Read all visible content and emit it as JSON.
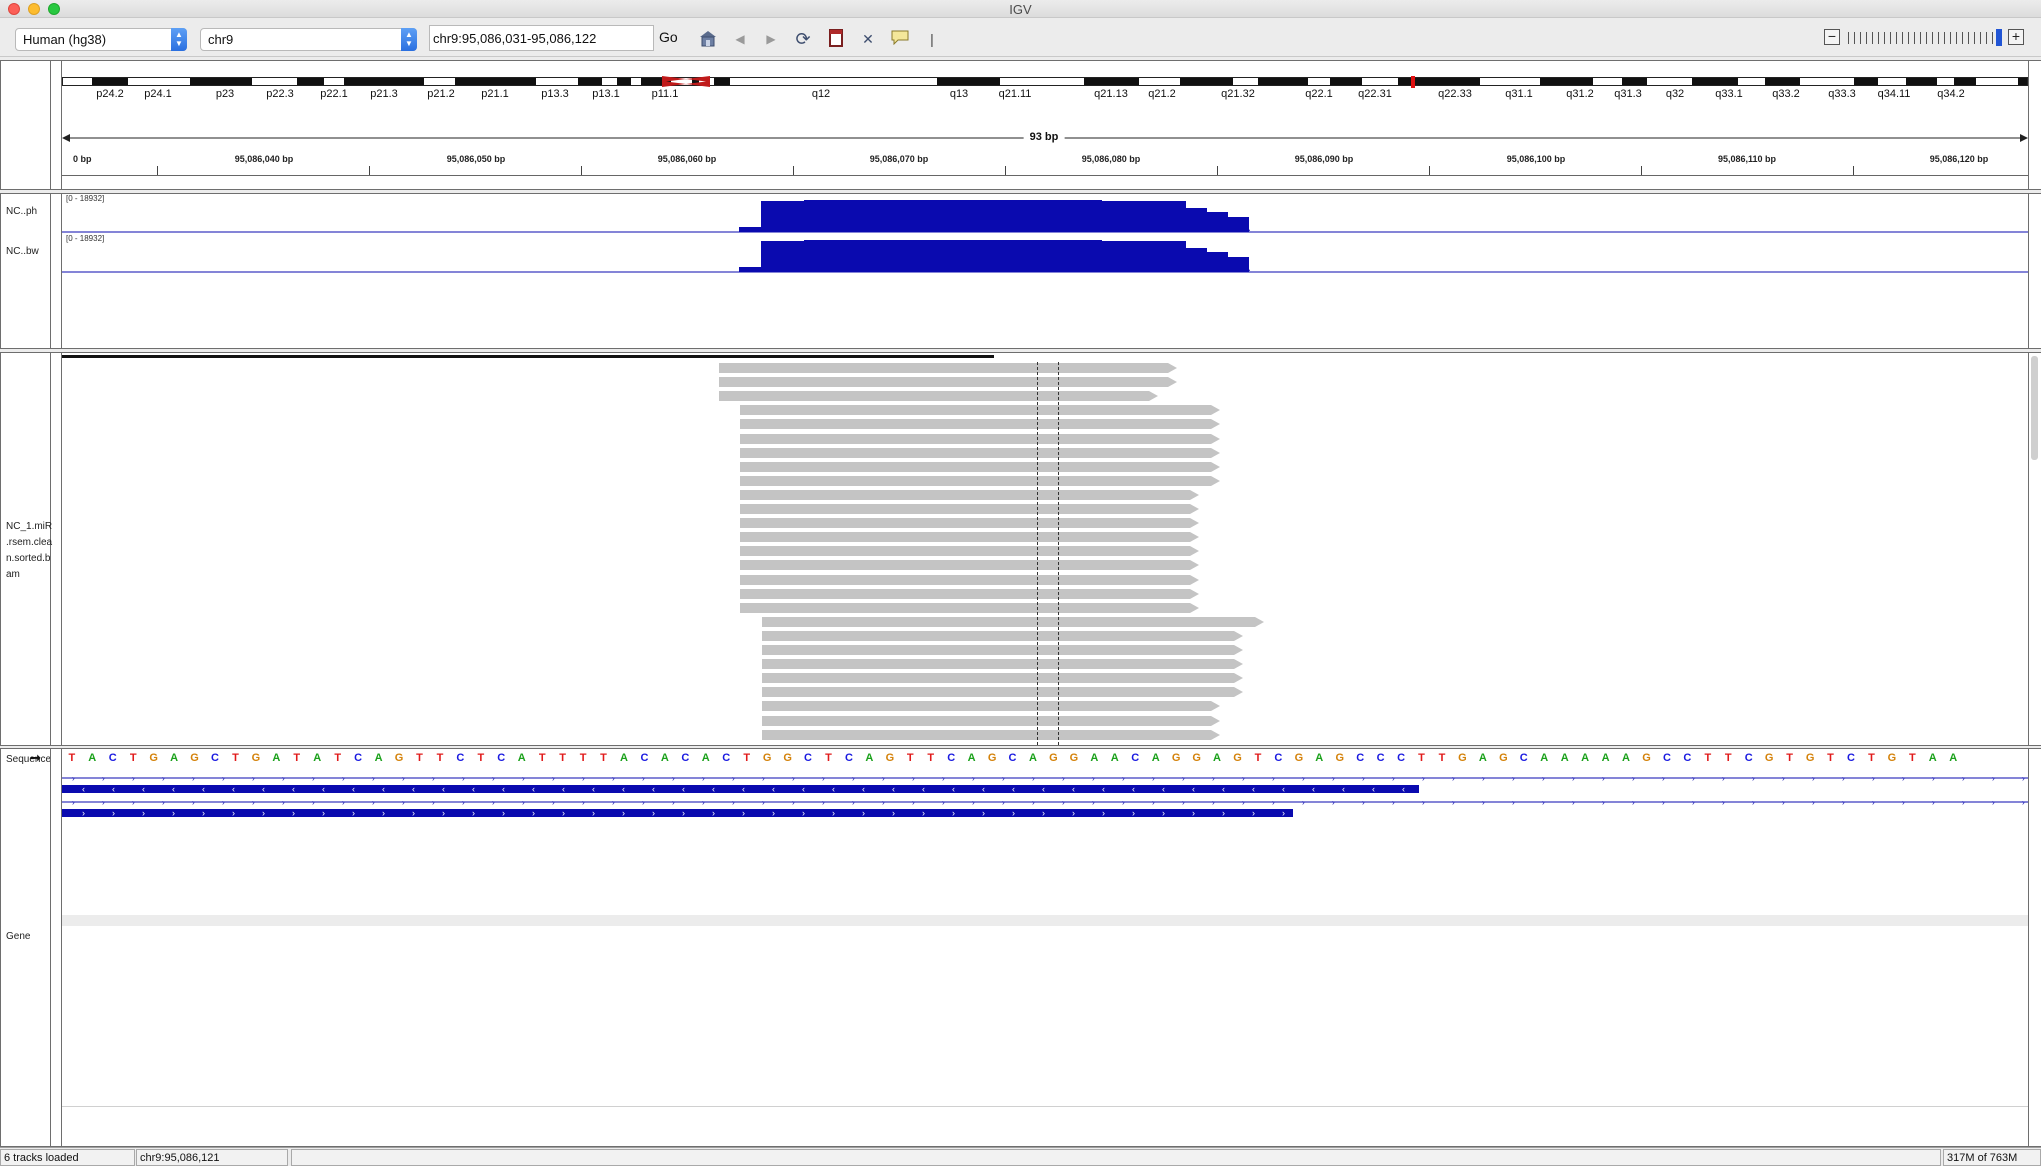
{
  "window": {
    "title": "IGV"
  },
  "toolbar": {
    "genome": "Human (hg38)",
    "chromosome": "chr9",
    "locus": "chr9:95,086,031-95,086,122",
    "go_label": "Go"
  },
  "ideogram": {
    "bands": [
      "p24.2",
      "p24.1",
      "p23",
      "p22.3",
      "p22.1",
      "p21.3",
      "p21.2",
      "p21.1",
      "p13.3",
      "p13.1",
      "p11.1",
      "q12",
      "q13",
      "q21.11",
      "q21.13",
      "q21.2",
      "q21.32",
      "q22.1",
      "q22.31",
      "q22.33",
      "q31.1",
      "q31.2",
      "q31.3",
      "q32",
      "q33.1",
      "q33.2",
      "q33.3",
      "q34.11",
      "q34.2"
    ]
  },
  "ruler": {
    "span_label": "93 bp",
    "ticks": [
      "0 bp",
      "95,086,040 bp",
      "95,086,050 bp",
      "95,086,060 bp",
      "95,086,070 bp",
      "95,086,080 bp",
      "95,086,090 bp",
      "95,086,100 bp",
      "95,086,110 bp",
      "95,086,120 bp"
    ]
  },
  "tracks": {
    "coverage1": {
      "name": "NC..ph",
      "range": "[0 - 18932]"
    },
    "coverage2": {
      "name": "NC..bw",
      "range": "[0 - 18932]"
    },
    "alignment": {
      "name": "NC_1.miR\n.rsem.clea\nn.sorted.b\nam"
    },
    "sequence": {
      "name": "Sequence"
    },
    "gene": {
      "name": "Gene"
    }
  },
  "sequence": "TACTGAGCTGATATCAGTTCTCATTTTACACACTGGCTCAGTTCAGCAGGAACAGGAGTCGAGCCCTTGAGCAAAAAGCCTTCGTGTCTGTAA",
  "base_colors": {
    "A": "#1aa11a",
    "C": "#1a1ae0",
    "G": "#d4820a",
    "T": "#e01a1a"
  },
  "colors": {
    "coverage": "#0a0aaf",
    "read": "#c4c4c4",
    "gene": "#0a0aaf"
  },
  "status": {
    "tracks_loaded": "6 tracks loaded",
    "position": "chr9:95,086,121",
    "memory": "317M of 763M"
  }
}
